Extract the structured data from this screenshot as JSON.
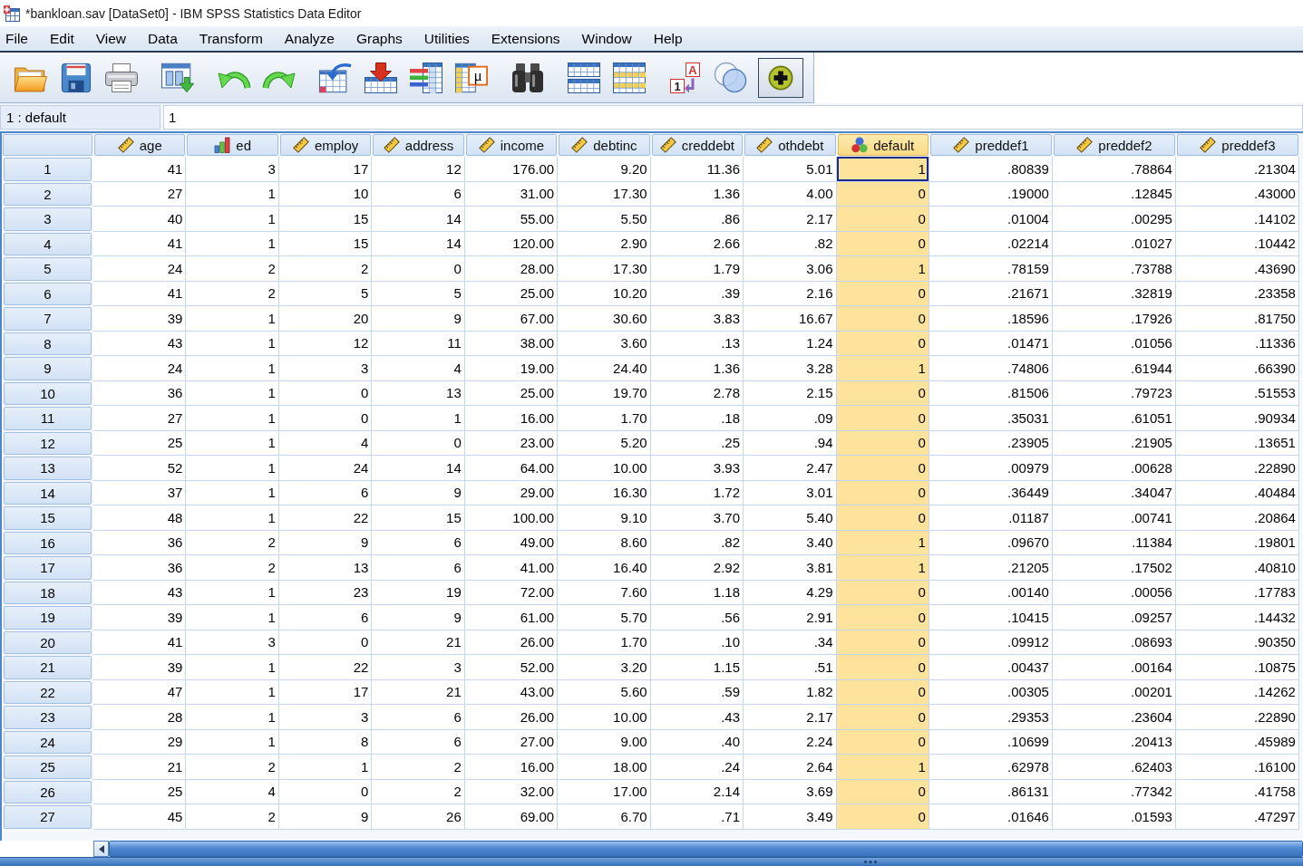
{
  "window": {
    "title": "*bankloan.sav [DataSet0] - IBM SPSS Statistics Data Editor"
  },
  "menu": [
    "File",
    "Edit",
    "View",
    "Data",
    "Transform",
    "Analyze",
    "Graphs",
    "Utilities",
    "Extensions",
    "Window",
    "Help"
  ],
  "toolbar": [
    {
      "buttons": [
        {
          "kind": "open",
          "pressed": false
        },
        {
          "kind": "save",
          "pressed": false
        },
        {
          "kind": "print",
          "pressed": false
        }
      ]
    },
    {
      "buttons": [
        {
          "kind": "recall",
          "pressed": false
        }
      ]
    },
    {
      "buttons": [
        {
          "kind": "undo",
          "pressed": false
        },
        {
          "kind": "redo",
          "pressed": false
        }
      ]
    },
    {
      "buttons": [
        {
          "kind": "go-to-case",
          "pressed": false
        },
        {
          "kind": "go-to-variable",
          "pressed": false
        },
        {
          "kind": "variables",
          "pressed": false
        },
        {
          "kind": "descriptives",
          "pressed": false,
          "glyphs": [
            "μ"
          ]
        }
      ]
    },
    {
      "buttons": [
        {
          "kind": "find",
          "pressed": false
        }
      ]
    },
    {
      "buttons": [
        {
          "kind": "split-file",
          "pressed": false
        },
        {
          "kind": "select-cases",
          "pressed": false
        }
      ]
    },
    {
      "buttons": [
        {
          "kind": "value-labels",
          "pressed": false,
          "glyphs": [
            "A",
            "1"
          ]
        },
        {
          "kind": "use-sets",
          "pressed": false
        },
        {
          "kind": "add-on",
          "pressed": true
        }
      ]
    }
  ],
  "cell_reference": {
    "name": "1 : default",
    "value": "1"
  },
  "grid": {
    "columns": [
      {
        "name": "age",
        "kind": "scale",
        "selected": false
      },
      {
        "name": "ed",
        "kind": "ordinal",
        "selected": false
      },
      {
        "name": "employ",
        "kind": "scale",
        "selected": false
      },
      {
        "name": "address",
        "kind": "scale",
        "selected": false
      },
      {
        "name": "income",
        "kind": "scale",
        "selected": false
      },
      {
        "name": "debtinc",
        "kind": "scale",
        "selected": false
      },
      {
        "name": "creddebt",
        "kind": "scale",
        "selected": false
      },
      {
        "name": "othdebt",
        "kind": "scale",
        "selected": false
      },
      {
        "name": "default",
        "kind": "nominal",
        "selected": true
      },
      {
        "name": "preddef1",
        "kind": "scale",
        "selected": false
      },
      {
        "name": "preddef2",
        "kind": "scale",
        "selected": false
      },
      {
        "name": "preddef3",
        "kind": "scale",
        "selected": false
      }
    ],
    "rows": [
      {
        "case": "1",
        "current": true,
        "values": [
          "41",
          "3",
          "17",
          "12",
          "176.00",
          "9.20",
          "11.36",
          "5.01",
          "1",
          ".80839",
          ".78864",
          ".21304"
        ]
      },
      {
        "case": "2",
        "current": false,
        "values": [
          "27",
          "1",
          "10",
          "6",
          "31.00",
          "17.30",
          "1.36",
          "4.00",
          "0",
          ".19000",
          ".12845",
          ".43000"
        ]
      },
      {
        "case": "3",
        "current": false,
        "values": [
          "40",
          "1",
          "15",
          "14",
          "55.00",
          "5.50",
          ".86",
          "2.17",
          "0",
          ".01004",
          ".00295",
          ".14102"
        ]
      },
      {
        "case": "4",
        "current": false,
        "values": [
          "41",
          "1",
          "15",
          "14",
          "120.00",
          "2.90",
          "2.66",
          ".82",
          "0",
          ".02214",
          ".01027",
          ".10442"
        ]
      },
      {
        "case": "5",
        "current": false,
        "values": [
          "24",
          "2",
          "2",
          "0",
          "28.00",
          "17.30",
          "1.79",
          "3.06",
          "1",
          ".78159",
          ".73788",
          ".43690"
        ]
      },
      {
        "case": "6",
        "current": false,
        "values": [
          "41",
          "2",
          "5",
          "5",
          "25.00",
          "10.20",
          ".39",
          "2.16",
          "0",
          ".21671",
          ".32819",
          ".23358"
        ]
      },
      {
        "case": "7",
        "current": false,
        "values": [
          "39",
          "1",
          "20",
          "9",
          "67.00",
          "30.60",
          "3.83",
          "16.67",
          "0",
          ".18596",
          ".17926",
          ".81750"
        ]
      },
      {
        "case": "8",
        "current": false,
        "values": [
          "43",
          "1",
          "12",
          "11",
          "38.00",
          "3.60",
          ".13",
          "1.24",
          "0",
          ".01471",
          ".01056",
          ".11336"
        ]
      },
      {
        "case": "9",
        "current": false,
        "values": [
          "24",
          "1",
          "3",
          "4",
          "19.00",
          "24.40",
          "1.36",
          "3.28",
          "1",
          ".74806",
          ".61944",
          ".66390"
        ]
      },
      {
        "case": "10",
        "current": false,
        "values": [
          "36",
          "1",
          "0",
          "13",
          "25.00",
          "19.70",
          "2.78",
          "2.15",
          "0",
          ".81506",
          ".79723",
          ".51553"
        ]
      },
      {
        "case": "11",
        "current": false,
        "values": [
          "27",
          "1",
          "0",
          "1",
          "16.00",
          "1.70",
          ".18",
          ".09",
          "0",
          ".35031",
          ".61051",
          ".90934"
        ]
      },
      {
        "case": "12",
        "current": false,
        "values": [
          "25",
          "1",
          "4",
          "0",
          "23.00",
          "5.20",
          ".25",
          ".94",
          "0",
          ".23905",
          ".21905",
          ".13651"
        ]
      },
      {
        "case": "13",
        "current": false,
        "values": [
          "52",
          "1",
          "24",
          "14",
          "64.00",
          "10.00",
          "3.93",
          "2.47",
          "0",
          ".00979",
          ".00628",
          ".22890"
        ]
      },
      {
        "case": "14",
        "current": false,
        "values": [
          "37",
          "1",
          "6",
          "9",
          "29.00",
          "16.30",
          "1.72",
          "3.01",
          "0",
          ".36449",
          ".34047",
          ".40484"
        ]
      },
      {
        "case": "15",
        "current": false,
        "values": [
          "48",
          "1",
          "22",
          "15",
          "100.00",
          "9.10",
          "3.70",
          "5.40",
          "0",
          ".01187",
          ".00741",
          ".20864"
        ]
      },
      {
        "case": "16",
        "current": false,
        "values": [
          "36",
          "2",
          "9",
          "6",
          "49.00",
          "8.60",
          ".82",
          "3.40",
          "1",
          ".09670",
          ".11384",
          ".19801"
        ]
      },
      {
        "case": "17",
        "current": false,
        "values": [
          "36",
          "2",
          "13",
          "6",
          "41.00",
          "16.40",
          "2.92",
          "3.81",
          "1",
          ".21205",
          ".17502",
          ".40810"
        ]
      },
      {
        "case": "18",
        "current": false,
        "values": [
          "43",
          "1",
          "23",
          "19",
          "72.00",
          "7.60",
          "1.18",
          "4.29",
          "0",
          ".00140",
          ".00056",
          ".17783"
        ]
      },
      {
        "case": "19",
        "current": false,
        "values": [
          "39",
          "1",
          "6",
          "9",
          "61.00",
          "5.70",
          ".56",
          "2.91",
          "0",
          ".10415",
          ".09257",
          ".14432"
        ]
      },
      {
        "case": "20",
        "current": false,
        "values": [
          "41",
          "3",
          "0",
          "21",
          "26.00",
          "1.70",
          ".10",
          ".34",
          "0",
          ".09912",
          ".08693",
          ".90350"
        ]
      },
      {
        "case": "21",
        "current": false,
        "values": [
          "39",
          "1",
          "22",
          "3",
          "52.00",
          "3.20",
          "1.15",
          ".51",
          "0",
          ".00437",
          ".00164",
          ".10875"
        ]
      },
      {
        "case": "22",
        "current": false,
        "values": [
          "47",
          "1",
          "17",
          "21",
          "43.00",
          "5.60",
          ".59",
          "1.82",
          "0",
          ".00305",
          ".00201",
          ".14262"
        ]
      },
      {
        "case": "23",
        "current": false,
        "values": [
          "28",
          "1",
          "3",
          "6",
          "26.00",
          "10.00",
          ".43",
          "2.17",
          "0",
          ".29353",
          ".23604",
          ".22890"
        ]
      },
      {
        "case": "24",
        "current": false,
        "values": [
          "29",
          "1",
          "8",
          "6",
          "27.00",
          "9.00",
          ".40",
          "2.24",
          "0",
          ".10699",
          ".20413",
          ".45989"
        ]
      },
      {
        "case": "25",
        "current": false,
        "values": [
          "21",
          "2",
          "1",
          "2",
          "16.00",
          "18.00",
          ".24",
          "2.64",
          "1",
          ".62978",
          ".62403",
          ".16100"
        ]
      },
      {
        "case": "26",
        "current": false,
        "values": [
          "25",
          "4",
          "0",
          "2",
          "32.00",
          "17.00",
          "2.14",
          "3.69",
          "0",
          ".86131",
          ".77342",
          ".41758"
        ]
      },
      {
        "case": "27",
        "current": false,
        "values": [
          "45",
          "2",
          "9",
          "26",
          "69.00",
          "6.70",
          ".71",
          "3.49",
          "0",
          ".01646",
          ".01593",
          ".47297"
        ]
      }
    ]
  }
}
